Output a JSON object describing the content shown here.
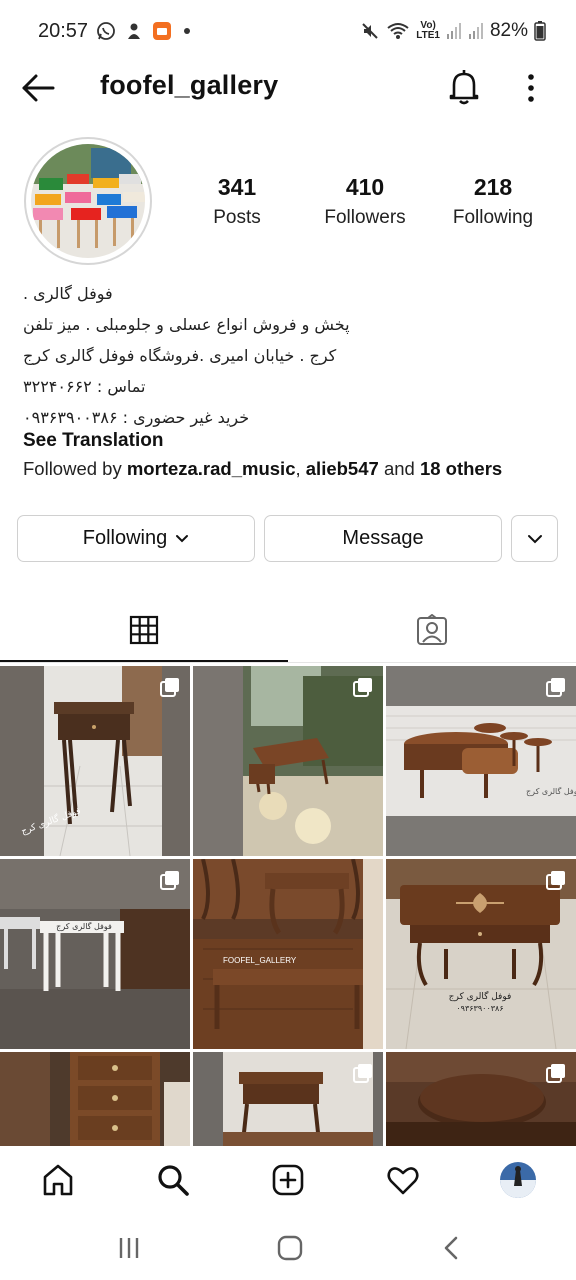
{
  "status_bar": {
    "time": "20:57",
    "battery": "82%",
    "network_line1": "Vo)",
    "network_line2": "LTE1"
  },
  "header": {
    "username": "foofel_gallery"
  },
  "stats": {
    "posts_count": "341",
    "posts_label": "Posts",
    "followers_count": "410",
    "followers_label": "Followers",
    "following_count": "218",
    "following_label": "Following"
  },
  "bio": {
    "lines": [
      "فوفل گالری .",
      "پخش و فروش انواع عسلی و جلومبلی . میز تلفن",
      "کرج . خیابان امیری .فروشگاه فوفل گالری کرج",
      "تماس : ۳۲۲۴۰۶۶۲",
      "خرید غیر حضوری : ۰۹۳۶۳۹۰۰۳۸۶"
    ],
    "see_translation": "See Translation",
    "followed_by_prefix": "Followed by",
    "followed_by_user1": "morteza.rad_music",
    "followed_by_user2": "alieb547",
    "followed_by_and": "and",
    "followed_by_others": "18 others"
  },
  "actions": {
    "following_label": "Following",
    "message_label": "Message"
  },
  "tabs": {
    "grid_icon": "grid-icon",
    "tagged_icon": "tagged-person-icon"
  },
  "posts": {
    "watermarks": {
      "p1": "فوفل گالری کرج",
      "p3": "فوفل گالری کرج",
      "p4": "فوفل گالری کرج",
      "p5": "FOOFEL_GALLERY",
      "p6a": "فوفل گالری کرج",
      "p6b": "۰۹۳۶۳۹۰۰۳۸۶"
    }
  },
  "bottom_nav": {
    "items": [
      "home-icon",
      "search-icon",
      "create-icon",
      "activity-heart-icon",
      "profile-avatar"
    ]
  },
  "colors": {
    "text": "#111111",
    "border": "#d0d0d0",
    "background": "#ffffff"
  }
}
